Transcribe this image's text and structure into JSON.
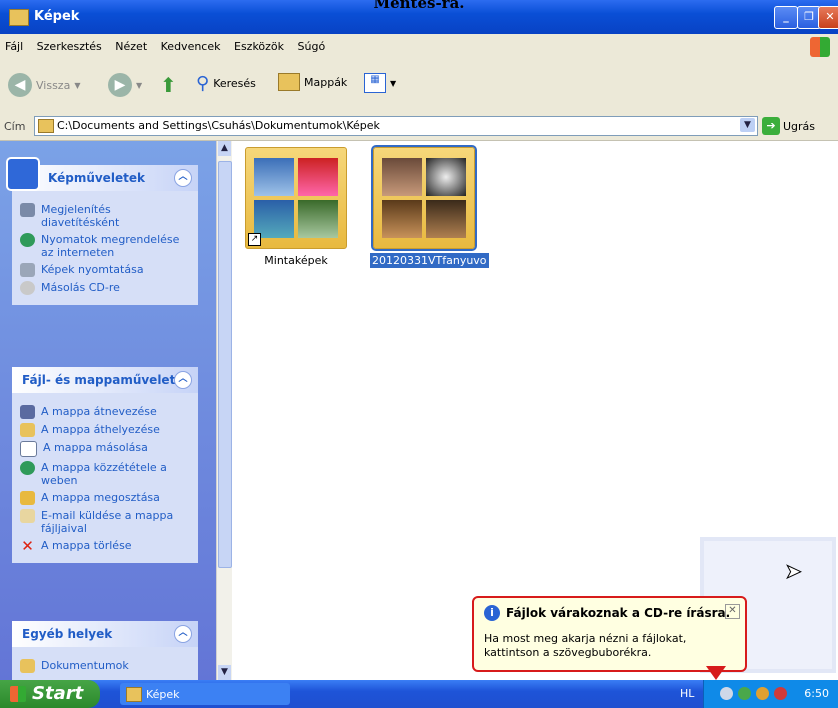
{
  "page_caption": "Mentés-ra.",
  "window": {
    "title": "Képek"
  },
  "menu": [
    "Fájl",
    "Szerkesztés",
    "Nézet",
    "Kedvencek",
    "Eszközök",
    "Súgó"
  ],
  "toolbar": {
    "back": "Vissza",
    "search": "Keresés",
    "folders": "Mappák"
  },
  "address": {
    "label": "Cím",
    "path": "C:\\Documents and Settings\\Csuhás\\Dokumentumok\\Képek",
    "go": "Ugrás"
  },
  "panels": {
    "image_tasks": {
      "title": "Képműveletek",
      "items": [
        "Megjelenítés diavetítésként",
        "Nyomatok megrendelése az interneten",
        "Képek nyomtatása",
        "Másolás CD-re"
      ]
    },
    "file_tasks": {
      "title": "Fájl- és mappaművelet",
      "items": [
        "A mappa átnevezése",
        "A mappa áthelyezése",
        "A mappa másolása",
        "A mappa közzététele a weben",
        "A mappa megosztása",
        "E-mail küldése a mappa fájljaival",
        "A mappa törlése"
      ]
    },
    "other_places": {
      "title": "Egyéb helyek",
      "items": [
        "Dokumentumok"
      ]
    }
  },
  "folders": [
    {
      "name": "Mintaképek",
      "selected": false
    },
    {
      "name": "20120331VTfanyuvo",
      "selected": true
    }
  ],
  "balloon": {
    "title": "Fájlok várakoznak a CD-re írásra.",
    "body": "Ha most meg akarja nézni a fájlokat, kattintson a szövegbuborékra."
  },
  "taskbar": {
    "start": "Start",
    "item": "Képek",
    "lang": "HL",
    "clock": "6:50"
  },
  "colors": {
    "title_blue": "#0a4fd6",
    "link_blue": "#215dc6",
    "selection": "#316ac5",
    "balloon_border": "#d71b1b"
  }
}
